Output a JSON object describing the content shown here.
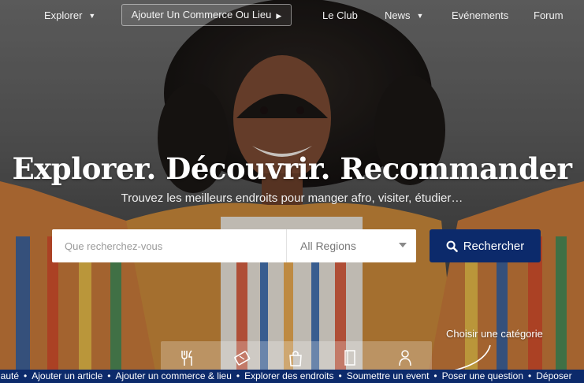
{
  "nav": {
    "explorer": "Explorer",
    "add_business": "Ajouter Un Commerce Ou Lieu",
    "club": "Le Club",
    "news": "News",
    "events": "Evénements",
    "forum": "Forum"
  },
  "hero": {
    "headline": "Explorer. Découvrir. Recommander",
    "subtitle": "Trouvez les meilleurs endroits pour manger afro, visiter, étudier…"
  },
  "search": {
    "placeholder": "Que recherchez-vous",
    "region_value": "All Regions",
    "button_label": "Rechercher"
  },
  "categories": {
    "label": "Choisir une catégorie",
    "icons": [
      "restaurant-icon",
      "ticket-icon",
      "shopping-bag-icon",
      "book-icon",
      "person-icon"
    ]
  },
  "ticker": {
    "items": [
      "nauté",
      "Ajouter un article",
      "Ajouter un commerce & lieu",
      "Explorer des endroits",
      "Soumettre un event",
      "Poser une question",
      "Déposer"
    ]
  },
  "colors": {
    "brand_blue": "#0c2a6b",
    "white": "#ffffff"
  }
}
